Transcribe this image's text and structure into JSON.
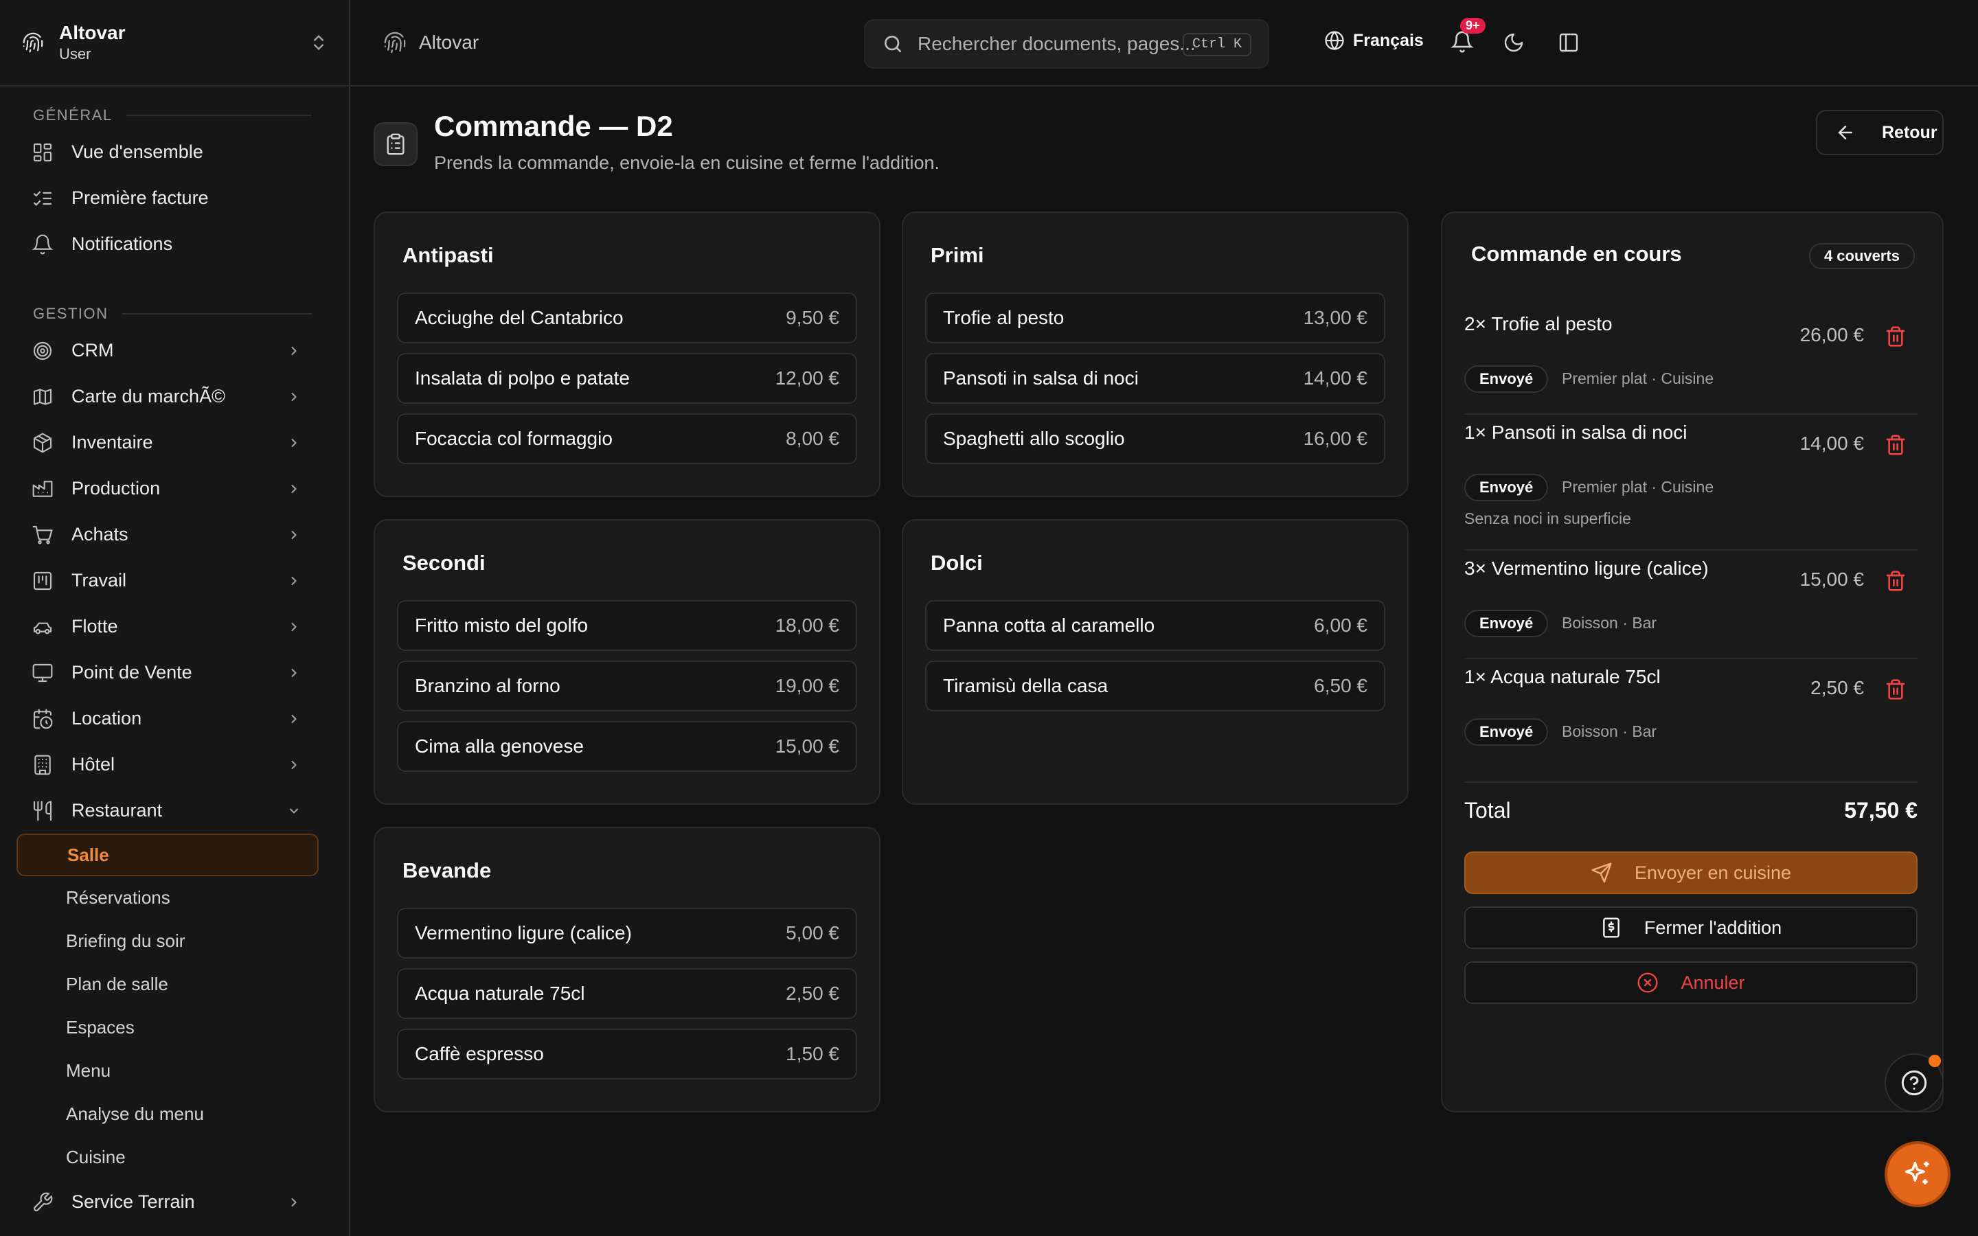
{
  "sidebar": {
    "brand_name": "Altovar",
    "brand_role": "User",
    "section_general": "GÉNÉRAL",
    "section_gestion": "GESTION",
    "general_items": [
      "Vue d'ensemble",
      "Première facture",
      "Notifications"
    ],
    "gestion_items": [
      "CRM",
      "Carte du marchÃ©",
      "Inventaire",
      "Production",
      "Achats",
      "Travail",
      "Flotte",
      "Point de Vente",
      "Location",
      "Hôtel",
      "Restaurant"
    ],
    "restaurant_sub": [
      "Salle",
      "Réservations",
      "Briefing du soir",
      "Plan de salle",
      "Espaces",
      "Menu",
      "Analyse du menu",
      "Cuisine"
    ],
    "last_item": "Service Terrain"
  },
  "topbar": {
    "breadcrumb": "Altovar",
    "search_placeholder": "Rechercher documents, pages...",
    "search_shortcut": "Ctrl K",
    "language": "Français",
    "notif_badge": "9+"
  },
  "header": {
    "title": "Commande — D2",
    "subtitle": "Prends la commande, envoie-la en cuisine et ferme l'addition.",
    "back_label": "Retour"
  },
  "menu": {
    "antipasti": {
      "title": "Antipasti",
      "items": [
        {
          "name": "Acciughe del Cantabrico",
          "price": "9,50 €"
        },
        {
          "name": "Insalata di polpo e patate",
          "price": "12,00 €"
        },
        {
          "name": "Focaccia col formaggio",
          "price": "8,00 €"
        }
      ]
    },
    "primi": {
      "title": "Primi",
      "items": [
        {
          "name": "Trofie al pesto",
          "price": "13,00 €"
        },
        {
          "name": "Pansoti in salsa di noci",
          "price": "14,00 €"
        },
        {
          "name": "Spaghetti allo scoglio",
          "price": "16,00 €"
        }
      ]
    },
    "secondi": {
      "title": "Secondi",
      "items": [
        {
          "name": "Fritto misto del golfo",
          "price": "18,00 €"
        },
        {
          "name": "Branzino al forno",
          "price": "19,00 €"
        },
        {
          "name": "Cima alla genovese",
          "price": "15,00 €"
        }
      ]
    },
    "dolci": {
      "title": "Dolci",
      "items": [
        {
          "name": "Panna cotta al caramello",
          "price": "6,00 €"
        },
        {
          "name": "Tiramisù della casa",
          "price": "6,50 €"
        }
      ]
    },
    "bevande": {
      "title": "Bevande",
      "items": [
        {
          "name": "Vermentino ligure (calice)",
          "price": "5,00 €"
        },
        {
          "name": "Acqua naturale 75cl",
          "price": "2,50 €"
        },
        {
          "name": "Caffè espresso",
          "price": "1,50 €"
        }
      ]
    }
  },
  "order": {
    "title": "Commande en cours",
    "covers": "4 couverts",
    "lines": [
      {
        "name": "2× Trofie al pesto",
        "price": "26,00 €",
        "status": "Envoyé",
        "meta": "Premier plat · Cuisine",
        "note": ""
      },
      {
        "name": "1× Pansoti in salsa di noci",
        "price": "14,00 €",
        "status": "Envoyé",
        "meta": "Premier plat · Cuisine",
        "note": "Senza noci in superficie"
      },
      {
        "name": "3× Vermentino ligure (calice)",
        "price": "15,00 €",
        "status": "Envoyé",
        "meta": "Boisson · Bar",
        "note": ""
      },
      {
        "name": "1× Acqua naturale 75cl",
        "price": "2,50 €",
        "status": "Envoyé",
        "meta": "Boisson · Bar",
        "note": ""
      }
    ],
    "total_label": "Total",
    "total_value": "57,50 €",
    "send_label": "Envoyer en cuisine",
    "close_label": "Fermer l'addition",
    "cancel_label": "Annuler"
  },
  "colors": {
    "accent": "#e4661a",
    "danger": "#ef4444",
    "background": "#121212"
  }
}
